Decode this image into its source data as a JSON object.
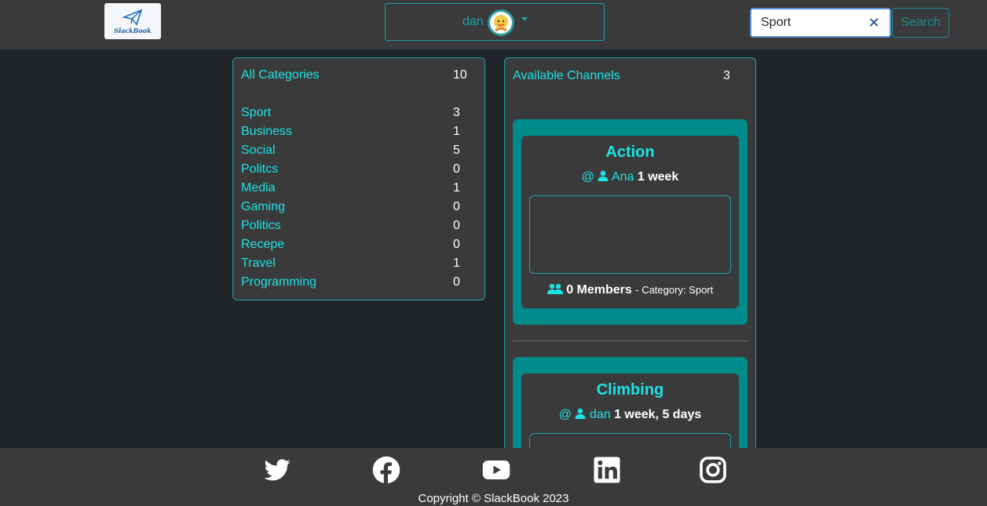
{
  "header": {
    "logo_text": "SlackBook",
    "user": {
      "name": "dan"
    },
    "search": {
      "value": "Sport",
      "placeholder": "",
      "button_label": "Search"
    }
  },
  "categories": {
    "header": {
      "label": "All Categories",
      "count": "10"
    },
    "items": [
      {
        "label": "Sport",
        "count": "3"
      },
      {
        "label": "Business",
        "count": "1"
      },
      {
        "label": "Social",
        "count": "5"
      },
      {
        "label": "Politcs",
        "count": "0"
      },
      {
        "label": "Media",
        "count": "1"
      },
      {
        "label": "Gaming",
        "count": "0"
      },
      {
        "label": "Politics",
        "count": "0"
      },
      {
        "label": "Recepe",
        "count": "0"
      },
      {
        "label": "Travel",
        "count": "1"
      },
      {
        "label": "Programming",
        "count": "0"
      }
    ]
  },
  "channels": {
    "header": {
      "label": "Available Channels",
      "count": "3"
    },
    "items": [
      {
        "title": "Action",
        "at": "@",
        "author": "Ana",
        "age": "1 week",
        "members": "0 Members",
        "category": "- Category: Sport"
      },
      {
        "title": "Climbing",
        "at": "@",
        "author": "dan",
        "age": "1 week, 5 days"
      }
    ]
  },
  "footer": {
    "social_icons": [
      "twitter-icon",
      "facebook-icon",
      "youtube-icon",
      "linkedin-icon",
      "instagram-icon"
    ],
    "copyright": "Copyright © SlackBook 2023"
  },
  "colors": {
    "accent": "#1de3e6",
    "teal": "#008b8b",
    "panel": "#3a3a3a",
    "background": "#212529"
  }
}
